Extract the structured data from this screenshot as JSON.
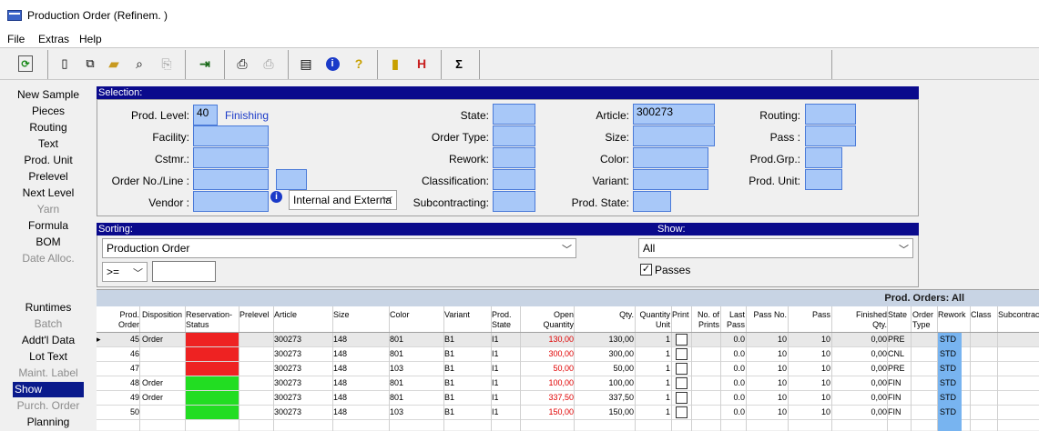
{
  "window": {
    "title": "Production Order (Refinem. )"
  },
  "menu": [
    "File",
    "Extras",
    "Help"
  ],
  "toolbar": {
    "icons": [
      "refresh-icon",
      "new-icon",
      "copy-icon",
      "open-folder-icon",
      "preview-icon",
      "paste-icon",
      "exit-icon",
      "print-icon",
      "print-setup-icon",
      "properties-icon",
      "info-icon",
      "help-icon",
      "notebook-icon",
      "filter-icon",
      "sum-icon"
    ],
    "sum_label": "Σ"
  },
  "nav": [
    {
      "label": "New Sample",
      "enabled": true
    },
    {
      "label": "Pieces",
      "enabled": true
    },
    {
      "label": "Routing",
      "enabled": true
    },
    {
      "label": "Text",
      "enabled": true
    },
    {
      "label": "Prod. Unit",
      "enabled": true
    },
    {
      "label": "Prelevel",
      "enabled": true
    },
    {
      "label": "Next Level",
      "enabled": true
    },
    {
      "label": "Yarn",
      "enabled": false
    },
    {
      "label": "Formula",
      "enabled": true
    },
    {
      "label": "BOM",
      "enabled": true
    },
    {
      "label": "Date Alloc.",
      "enabled": false
    },
    {
      "label": "Runtimes",
      "enabled": true
    },
    {
      "label": "Batch",
      "enabled": false
    },
    {
      "label": "Addt'l Data",
      "enabled": true
    },
    {
      "label": "Lot Text",
      "enabled": true
    },
    {
      "label": "Maint. Label",
      "enabled": false
    },
    {
      "label": "Show",
      "enabled": true,
      "selected": true
    },
    {
      "label": "Purch. Order",
      "enabled": false
    },
    {
      "label": "Planning",
      "enabled": true
    }
  ],
  "selection": {
    "title": "Selection:",
    "prod_level_label": "Prod. Level:",
    "prod_level_value": "40",
    "prod_level_desc": "Finishing",
    "facility_label": "Facility:",
    "cstmr_label": "Cstmr.:",
    "order_no_label": "Order No./Line :",
    "vendor_label": "Vendor   :",
    "vendor_combo": "Internal and Externa",
    "state_label": "State:",
    "order_type_label": "Order Type:",
    "rework_label": "Rework:",
    "classification_label": "Classification:",
    "subcontracting_label": "Subcontracting:",
    "article_label": "Article:",
    "article_value": "300273",
    "size_label": "Size:",
    "color_label": "Color:",
    "variant_label": "Variant:",
    "prod_state_label": "Prod. State:",
    "routing_label": "Routing:",
    "pass_label": "Pass      :",
    "prod_grp_label": "Prod.Grp.:",
    "prod_unit_label": "Prod. Unit:"
  },
  "sorting": {
    "title": "Sorting:",
    "value": "Production Order",
    "op": ">=",
    "op_value": ""
  },
  "show": {
    "title": "Show:",
    "value": "All",
    "passes_label": "Passes",
    "passes_checked": true
  },
  "grid": {
    "title": "Prod. Orders: All",
    "headers": [
      {
        "l1": "Prod.",
        "l2": "Order"
      },
      {
        "l1": "",
        "l2": "Disposition"
      },
      {
        "l1": "Reservation-",
        "l2": "Status"
      },
      {
        "l1": "",
        "l2": "Prelevel"
      },
      {
        "l1": "",
        "l2": "Article"
      },
      {
        "l1": "",
        "l2": "Size"
      },
      {
        "l1": "",
        "l2": "Color"
      },
      {
        "l1": "",
        "l2": "Variant"
      },
      {
        "l1": "Prod.",
        "l2": "State"
      },
      {
        "l1": "Open",
        "l2": "Quantity"
      },
      {
        "l1": "",
        "l2": "Qty."
      },
      {
        "l1": "Quantity",
        "l2": "Unit"
      },
      {
        "l1": "",
        "l2": "Print"
      },
      {
        "l1": "No. of",
        "l2": "Prints"
      },
      {
        "l1": "Last",
        "l2": "Pass"
      },
      {
        "l1": "",
        "l2": "Pass No."
      },
      {
        "l1": "",
        "l2": "Pass"
      },
      {
        "l1": "Finished",
        "l2": "Qty."
      },
      {
        "l1": "",
        "l2": "State"
      },
      {
        "l1": "Order",
        "l2": "Type"
      },
      {
        "l1": "",
        "l2": "Rework"
      },
      {
        "l1": "",
        "l2": "Class"
      },
      {
        "l1": "",
        "l2": "Subcontrac"
      }
    ],
    "rows": [
      {
        "order": "45",
        "disp": "Order",
        "res": "#ee2222",
        "article": "300273",
        "size": "148",
        "color": "801",
        "variant": "B1",
        "state": "I1",
        "open": "130,00",
        "qty": "130,00",
        "unit": "1",
        "prints": "0.0",
        "lastpass": "10",
        "passno": "10",
        "finished": "0,00",
        "st": "PRE",
        "type": "STD"
      },
      {
        "order": "46",
        "disp": "",
        "res": "#ee2222",
        "article": "300273",
        "size": "148",
        "color": "801",
        "variant": "B1",
        "state": "I1",
        "open": "300,00",
        "qty": "300,00",
        "unit": "1",
        "prints": "0.0",
        "lastpass": "10",
        "passno": "10",
        "finished": "0,00",
        "st": "CNL",
        "type": "STD"
      },
      {
        "order": "47",
        "disp": "",
        "res": "#ee2222",
        "article": "300273",
        "size": "148",
        "color": "103",
        "variant": "B1",
        "state": "I1",
        "open": "50,00",
        "qty": "50,00",
        "unit": "1",
        "prints": "0.0",
        "lastpass": "10",
        "passno": "10",
        "finished": "0,00",
        "st": "PRE",
        "type": "STD"
      },
      {
        "order": "48",
        "disp": "Order",
        "res": "#22dd22",
        "article": "300273",
        "size": "148",
        "color": "801",
        "variant": "B1",
        "state": "I1",
        "open": "100,00",
        "qty": "100,00",
        "unit": "1",
        "prints": "0.0",
        "lastpass": "10",
        "passno": "10",
        "finished": "0,00",
        "st": "FIN",
        "type": "STD"
      },
      {
        "order": "49",
        "disp": "Order",
        "res": "#22dd22",
        "article": "300273",
        "size": "148",
        "color": "801",
        "variant": "B1",
        "state": "I1",
        "open": "337,50",
        "qty": "337,50",
        "unit": "1",
        "prints": "0.0",
        "lastpass": "10",
        "passno": "10",
        "finished": "0,00",
        "st": "FIN",
        "type": "STD"
      },
      {
        "order": "50",
        "disp": "",
        "res": "#22dd22",
        "article": "300273",
        "size": "148",
        "color": "103",
        "variant": "B1",
        "state": "I1",
        "open": "150,00",
        "qty": "150,00",
        "unit": "1",
        "prints": "0.0",
        "lastpass": "10",
        "passno": "10",
        "finished": "0,00",
        "st": "FIN",
        "type": "STD"
      }
    ]
  }
}
